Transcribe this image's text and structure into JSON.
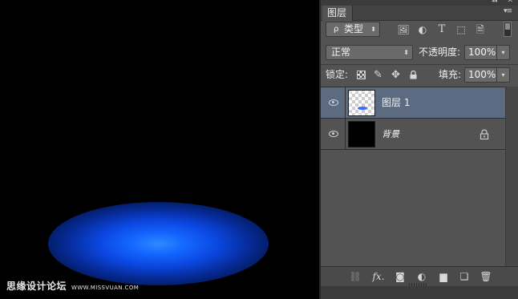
{
  "canvas": {
    "watermark_cn": "思缘设计论坛",
    "watermark_url": "WWW.MISSVUAN.COM",
    "glow_color": "#1466ff"
  },
  "panel": {
    "topbar_arrows": "◂◂",
    "close_glyph": "✕",
    "tab_label": "图层",
    "menu_glyph": "▾≡",
    "kind_filter": {
      "search_glyph": "ρ",
      "label": "类型",
      "arrow": "⬍"
    },
    "filter_icons": {
      "image": "🖼",
      "adjustment": "◐",
      "type": "T",
      "shape": "⬚",
      "smart_object": "🗎"
    },
    "blend_mode": {
      "value": "正常",
      "arrow": "⬍"
    },
    "opacity": {
      "label": "不透明度:",
      "value": "100%",
      "arrow": "▾"
    },
    "lock": {
      "label": "锁定:",
      "brush_glyph": "✎",
      "move_glyph": "✥"
    },
    "fill": {
      "label": "填充:",
      "value": "100%",
      "arrow": "▾"
    },
    "layers": [
      {
        "name": "图层 1",
        "selected": true,
        "visible": true
      },
      {
        "name": "背景",
        "selected": false,
        "visible": true,
        "locked": true
      }
    ],
    "bottom_icons": {
      "link": "⛓",
      "fx": "fx.",
      "mask": "◙",
      "adjustment": "◐",
      "group": "▆",
      "new_layer": "❏",
      "delete": "🗑"
    },
    "colors": {
      "panel_bg": "#535353",
      "selected_row": "#5c6b82",
      "dark_border": "#2e2e2e"
    }
  }
}
